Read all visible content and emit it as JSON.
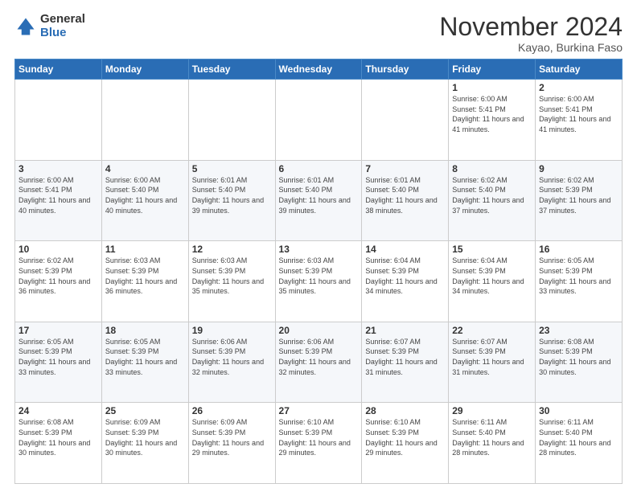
{
  "logo": {
    "general": "General",
    "blue": "Blue"
  },
  "title": "November 2024",
  "location": "Kayao, Burkina Faso",
  "days_of_week": [
    "Sunday",
    "Monday",
    "Tuesday",
    "Wednesday",
    "Thursday",
    "Friday",
    "Saturday"
  ],
  "weeks": [
    [
      {
        "day": "",
        "info": ""
      },
      {
        "day": "",
        "info": ""
      },
      {
        "day": "",
        "info": ""
      },
      {
        "day": "",
        "info": ""
      },
      {
        "day": "",
        "info": ""
      },
      {
        "day": "1",
        "info": "Sunrise: 6:00 AM\nSunset: 5:41 PM\nDaylight: 11 hours and 41 minutes."
      },
      {
        "day": "2",
        "info": "Sunrise: 6:00 AM\nSunset: 5:41 PM\nDaylight: 11 hours and 41 minutes."
      }
    ],
    [
      {
        "day": "3",
        "info": "Sunrise: 6:00 AM\nSunset: 5:41 PM\nDaylight: 11 hours and 40 minutes."
      },
      {
        "day": "4",
        "info": "Sunrise: 6:00 AM\nSunset: 5:40 PM\nDaylight: 11 hours and 40 minutes."
      },
      {
        "day": "5",
        "info": "Sunrise: 6:01 AM\nSunset: 5:40 PM\nDaylight: 11 hours and 39 minutes."
      },
      {
        "day": "6",
        "info": "Sunrise: 6:01 AM\nSunset: 5:40 PM\nDaylight: 11 hours and 39 minutes."
      },
      {
        "day": "7",
        "info": "Sunrise: 6:01 AM\nSunset: 5:40 PM\nDaylight: 11 hours and 38 minutes."
      },
      {
        "day": "8",
        "info": "Sunrise: 6:02 AM\nSunset: 5:40 PM\nDaylight: 11 hours and 37 minutes."
      },
      {
        "day": "9",
        "info": "Sunrise: 6:02 AM\nSunset: 5:39 PM\nDaylight: 11 hours and 37 minutes."
      }
    ],
    [
      {
        "day": "10",
        "info": "Sunrise: 6:02 AM\nSunset: 5:39 PM\nDaylight: 11 hours and 36 minutes."
      },
      {
        "day": "11",
        "info": "Sunrise: 6:03 AM\nSunset: 5:39 PM\nDaylight: 11 hours and 36 minutes."
      },
      {
        "day": "12",
        "info": "Sunrise: 6:03 AM\nSunset: 5:39 PM\nDaylight: 11 hours and 35 minutes."
      },
      {
        "day": "13",
        "info": "Sunrise: 6:03 AM\nSunset: 5:39 PM\nDaylight: 11 hours and 35 minutes."
      },
      {
        "day": "14",
        "info": "Sunrise: 6:04 AM\nSunset: 5:39 PM\nDaylight: 11 hours and 34 minutes."
      },
      {
        "day": "15",
        "info": "Sunrise: 6:04 AM\nSunset: 5:39 PM\nDaylight: 11 hours and 34 minutes."
      },
      {
        "day": "16",
        "info": "Sunrise: 6:05 AM\nSunset: 5:39 PM\nDaylight: 11 hours and 33 minutes."
      }
    ],
    [
      {
        "day": "17",
        "info": "Sunrise: 6:05 AM\nSunset: 5:39 PM\nDaylight: 11 hours and 33 minutes."
      },
      {
        "day": "18",
        "info": "Sunrise: 6:05 AM\nSunset: 5:39 PM\nDaylight: 11 hours and 33 minutes."
      },
      {
        "day": "19",
        "info": "Sunrise: 6:06 AM\nSunset: 5:39 PM\nDaylight: 11 hours and 32 minutes."
      },
      {
        "day": "20",
        "info": "Sunrise: 6:06 AM\nSunset: 5:39 PM\nDaylight: 11 hours and 32 minutes."
      },
      {
        "day": "21",
        "info": "Sunrise: 6:07 AM\nSunset: 5:39 PM\nDaylight: 11 hours and 31 minutes."
      },
      {
        "day": "22",
        "info": "Sunrise: 6:07 AM\nSunset: 5:39 PM\nDaylight: 11 hours and 31 minutes."
      },
      {
        "day": "23",
        "info": "Sunrise: 6:08 AM\nSunset: 5:39 PM\nDaylight: 11 hours and 30 minutes."
      }
    ],
    [
      {
        "day": "24",
        "info": "Sunrise: 6:08 AM\nSunset: 5:39 PM\nDaylight: 11 hours and 30 minutes."
      },
      {
        "day": "25",
        "info": "Sunrise: 6:09 AM\nSunset: 5:39 PM\nDaylight: 11 hours and 30 minutes."
      },
      {
        "day": "26",
        "info": "Sunrise: 6:09 AM\nSunset: 5:39 PM\nDaylight: 11 hours and 29 minutes."
      },
      {
        "day": "27",
        "info": "Sunrise: 6:10 AM\nSunset: 5:39 PM\nDaylight: 11 hours and 29 minutes."
      },
      {
        "day": "28",
        "info": "Sunrise: 6:10 AM\nSunset: 5:39 PM\nDaylight: 11 hours and 29 minutes."
      },
      {
        "day": "29",
        "info": "Sunrise: 6:11 AM\nSunset: 5:40 PM\nDaylight: 11 hours and 28 minutes."
      },
      {
        "day": "30",
        "info": "Sunrise: 6:11 AM\nSunset: 5:40 PM\nDaylight: 11 hours and 28 minutes."
      }
    ]
  ]
}
